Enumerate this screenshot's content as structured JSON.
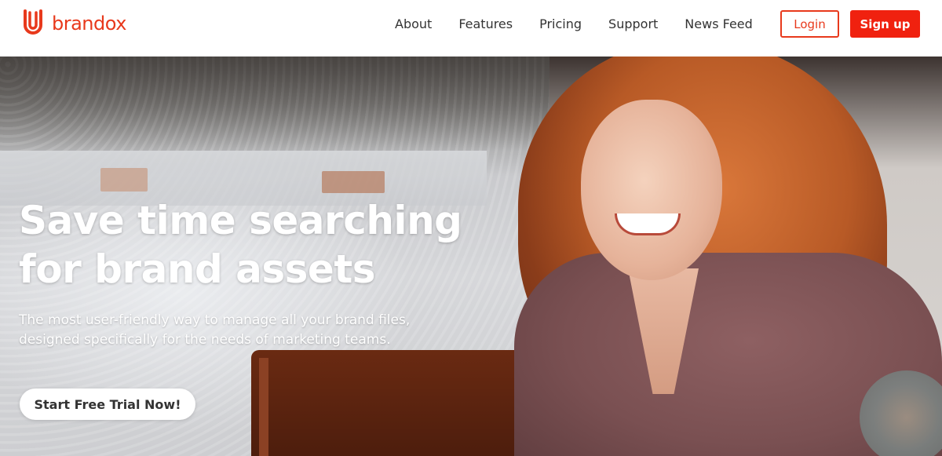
{
  "brand": {
    "name": "brandox",
    "logo_icon": "brandox-logo-icon",
    "accent": "#e8391c"
  },
  "nav": {
    "items": [
      {
        "label": "About"
      },
      {
        "label": "Features"
      },
      {
        "label": "Pricing"
      },
      {
        "label": "Support"
      },
      {
        "label": "News Feed"
      }
    ],
    "login_label": "Login",
    "signup_label": "Sign up"
  },
  "hero": {
    "title_line1": "Save time searching",
    "title_line2": "for brand assets",
    "subtitle_line1": "The most user-friendly way to manage all your brand files,",
    "subtitle_line2": "designed specifically for the needs of marketing teams.",
    "cta_label": "Start Free Trial Now!"
  },
  "colors": {
    "primary_red": "#f0210f",
    "nav_text": "#333333"
  }
}
